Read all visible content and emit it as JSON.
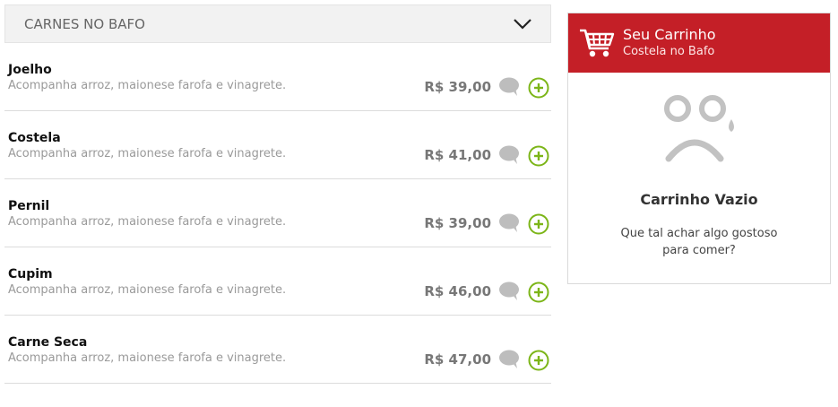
{
  "menu": {
    "section_title": "CARNES NO BAFO",
    "items": [
      {
        "name": "Joelho",
        "description": "Acompanha arroz, maionese farofa e vinagrete.",
        "price": "R$ 39,00"
      },
      {
        "name": "Costela",
        "description": "Acompanha arroz, maionese farofa e vinagrete.",
        "price": "R$ 41,00"
      },
      {
        "name": "Pernil",
        "description": "Acompanha arroz, maionese farofa e vinagrete.",
        "price": "R$ 39,00"
      },
      {
        "name": "Cupim",
        "description": "Acompanha arroz, maionese farofa e vinagrete.",
        "price": "R$ 46,00"
      },
      {
        "name": "Carne Seca",
        "description": "Acompanha arroz, maionese farofa e vinagrete.",
        "price": "R$ 47,00"
      }
    ],
    "icons": {
      "expand": "chevron-down-icon",
      "comment": "comment-icon",
      "add": "add-circle-icon"
    }
  },
  "cart": {
    "title": "Seu Carrinho",
    "subtitle": "Costela no Bafo",
    "empty_title": "Carrinho Vazio",
    "empty_message": "Que tal achar algo gostoso para comer?",
    "icons": {
      "cart": "shopping-cart-icon",
      "empty": "sad-face-icon"
    }
  },
  "colors": {
    "brand_red": "#c41f27",
    "add_green": "#7cb518",
    "muted_gray": "#bdbdbd",
    "header_bg": "#f2f2f2"
  }
}
